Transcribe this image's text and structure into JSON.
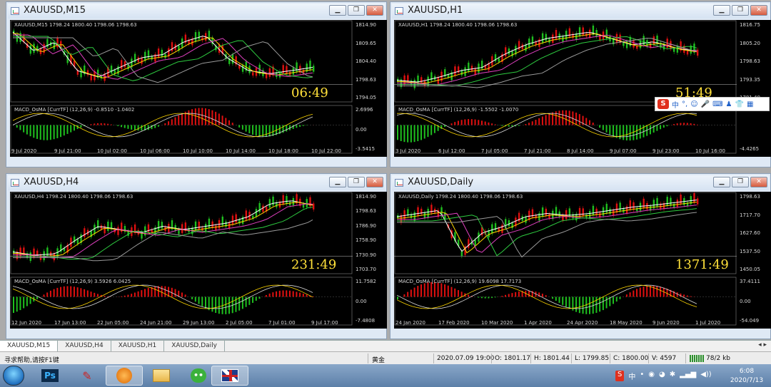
{
  "colors": {
    "bg": "#000000",
    "bull": "#1fbf1f",
    "bear": "#e01010",
    "yellow": "#ffd700",
    "white": "#ffffff",
    "magenta": "#e040c0",
    "green": "#2ecc40",
    "gray": "#9a9a9a",
    "timer": "#ffe03a"
  },
  "windows": [
    {
      "title": "XAUUSD,M15",
      "info": "XAUUSD,M15  1798.24 1800.40 1798.06 1798.63",
      "prices": [
        "1814.90",
        "1809.65",
        "1804.40",
        "1798.63",
        "1794.05"
      ],
      "macd_info": "MACD_OsMA [CurrTF] (12,26,9) -0.8510 -1.0402",
      "macd_scale": [
        "2.6996",
        "0.00",
        "-3.5415"
      ],
      "dates": [
        "9 Jul 2020",
        "9 Jul 21:00",
        "10 Jul 02:00",
        "10 Jul 06:00",
        "10 Jul 10:00",
        "10 Jul 14:00",
        "10 Jul 18:00",
        "10 Jul 22:00"
      ],
      "timer": "06:49"
    },
    {
      "title": "XAUUSD,H1",
      "info": "XAUUSD,H1  1798.24 1800.40 1798.06 1798.63",
      "prices": [
        "1816.75",
        "1805.20",
        "1798.63",
        "1793.35",
        "1781.40"
      ],
      "macd_info": "MACD_OsMA [CurrTF] (12,26,9) -1.5502 -1.0070",
      "macd_scale": [
        "0.00",
        "-4.4265"
      ],
      "dates": [
        "3 Jul 2020",
        "6 Jul 12:00",
        "7 Jul 05:00",
        "7 Jul 21:00",
        "8 Jul 14:00",
        "9 Jul 07:00",
        "9 Jul 23:00",
        "10 Jul 16:00"
      ],
      "timer": "51:49"
    },
    {
      "title": "XAUUSD,H4",
      "info": "XAUUSD,H4  1798.24 1800.40 1798.06 1798.63",
      "prices": [
        "1814.90",
        "1798.63",
        "1786.90",
        "1758.90",
        "1730.90",
        "1703.70"
      ],
      "macd_info": "MACD_OsMA [CurrTF] (12,26,9) 3.5926 6.0425",
      "macd_scale": [
        "11.7582",
        "0.00",
        "-7.4808"
      ],
      "dates": [
        "12 Jun 2020",
        "17 Jun 13:00",
        "22 Jun 05:00",
        "24 Jun 21:00",
        "29 Jun 13:00",
        "2 Jul 05:00",
        "7 Jul 01:00",
        "9 Jul 17:00"
      ],
      "timer": "231:49"
    },
    {
      "title": "XAUUSD,Daily",
      "info": "XAUUSD,Daily  1798.24 1800.40 1798.06 1798.63",
      "prices": [
        "1798.63",
        "1717.70",
        "1627.60",
        "1537.50",
        "1450.05"
      ],
      "macd_info": "MACD_OsMA [CurrTF] (12,26,9) 19.6098 17.7173",
      "macd_scale": [
        "37.4111",
        "0.00",
        "-54.049"
      ],
      "dates": [
        "24 Jan 2020",
        "17 Feb 2020",
        "10 Mar 2020",
        "1 Apr 2020",
        "24 Apr 2020",
        "18 May 2020",
        "9 Jun 2020",
        "1 Jul 2020"
      ],
      "timer": "1371:49"
    }
  ],
  "tabs": [
    "XAUUSD,M15",
    "XAUUSD,H4",
    "XAUUSD,H1",
    "XAUUSD,Daily"
  ],
  "status": {
    "help": "寻求帮助,请按F1键",
    "symbol": "黄金",
    "datetime": "2020.07.09 19:00",
    "open": "O: 1801.17",
    "high": "H: 1801.44",
    "low": "L: 1799.85",
    "close": "C: 1800.00",
    "volume": "V: 4597",
    "traffic": "78/2 kb"
  },
  "ime": {
    "logo": "S",
    "lang": "中"
  },
  "taskbar": {
    "items": [
      "Ps",
      "MT4",
      "Web",
      "Files",
      "WeChat",
      "Flag"
    ]
  },
  "clock": {
    "time": "6:08",
    "date": "2020/7/13"
  }
}
